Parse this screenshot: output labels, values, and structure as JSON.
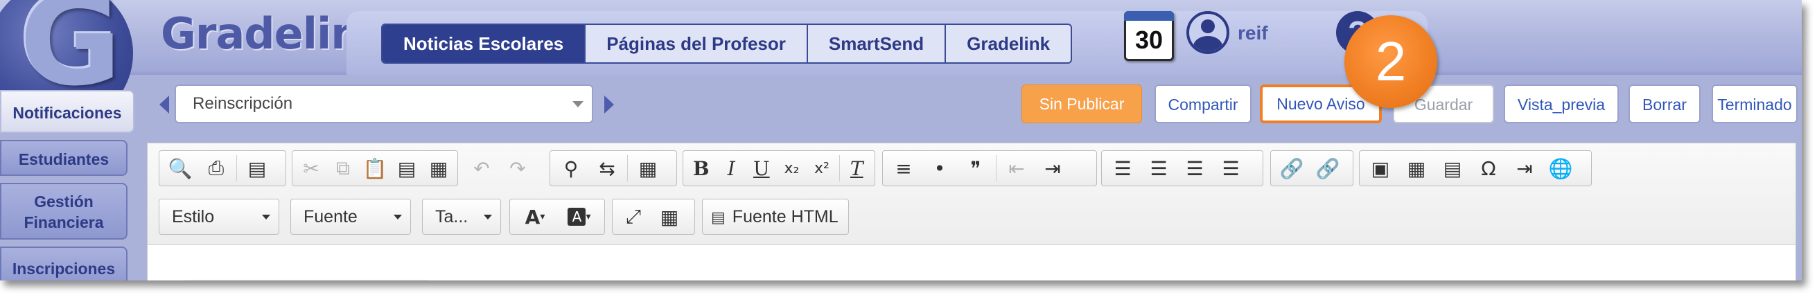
{
  "header": {
    "logo_glyph": "G",
    "logo_text": "Gradelink",
    "tabs": [
      {
        "label": "Noticias Escolares",
        "active": true
      },
      {
        "label": "Páginas del Profesor",
        "active": false
      },
      {
        "label": "SmartSend",
        "active": false
      },
      {
        "label": "Gradelink",
        "active": false
      }
    ],
    "calendar_day": "30",
    "username": "reif",
    "help_glyph": "?",
    "step_badge": "2"
  },
  "sidebar": {
    "items": [
      {
        "label": "Notificaciones",
        "active": true
      },
      {
        "label": "Estudiantes",
        "active": false
      },
      {
        "label": "Gestión Financiera",
        "active": false
      },
      {
        "label": "Inscripciones",
        "active": false
      }
    ]
  },
  "notice_select": {
    "value": "Reinscripción"
  },
  "actions": {
    "unpublished": "Sin Publicar",
    "share": "Compartir",
    "new_notice": "Nuevo Aviso",
    "save": "Guardar",
    "preview": "Vista_previa",
    "delete": "Borrar",
    "done": "Terminado"
  },
  "editor": {
    "style_label": "Estilo",
    "font_label": "Fuente",
    "size_label": "Ta...",
    "source_label": "Fuente HTML",
    "glyphs": {
      "bold": "B",
      "italic": "I",
      "underline": "U",
      "subscript": "x₂",
      "superscript": "x²",
      "clear_format": "T",
      "blockquote": "❞",
      "omega": "Ω",
      "text_color_letter": "A",
      "bg_color_letter": "A"
    }
  },
  "colors": {
    "brand_dark": "#2f3f8f",
    "accent_orange": "#f07e22",
    "unpublished_orange": "#f7a14b",
    "link_blue": "#2f56b8"
  }
}
